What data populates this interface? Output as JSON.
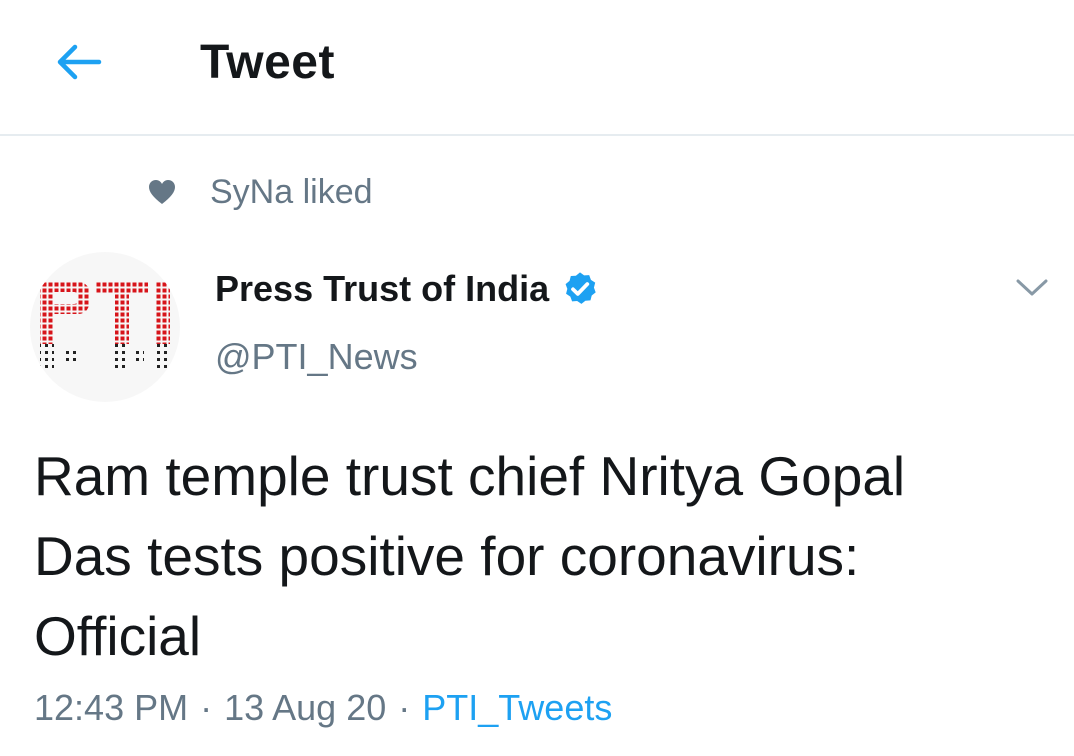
{
  "header": {
    "title": "Tweet",
    "back_icon": "arrow-left-icon"
  },
  "social_context": {
    "icon": "heart-icon",
    "text": "SyNa liked"
  },
  "author": {
    "name": "Press Trust of India",
    "handle": "@PTI_News",
    "verified_icon": "verified-badge-icon",
    "avatar_logo_text": "PTI"
  },
  "tweet": {
    "line1": "Ram temple trust chief Nritya Gopal",
    "line2": "Das tests positive for coronavirus:",
    "line3": "Official"
  },
  "meta": {
    "time": "12:43 PM",
    "separator": "·",
    "date": "13 Aug 20",
    "source": "PTI_Tweets"
  },
  "colors": {
    "accent": "#1da1f2",
    "secondary_text": "#657786",
    "logo_red": "#d7141a",
    "divider": "#e6ecf0"
  }
}
